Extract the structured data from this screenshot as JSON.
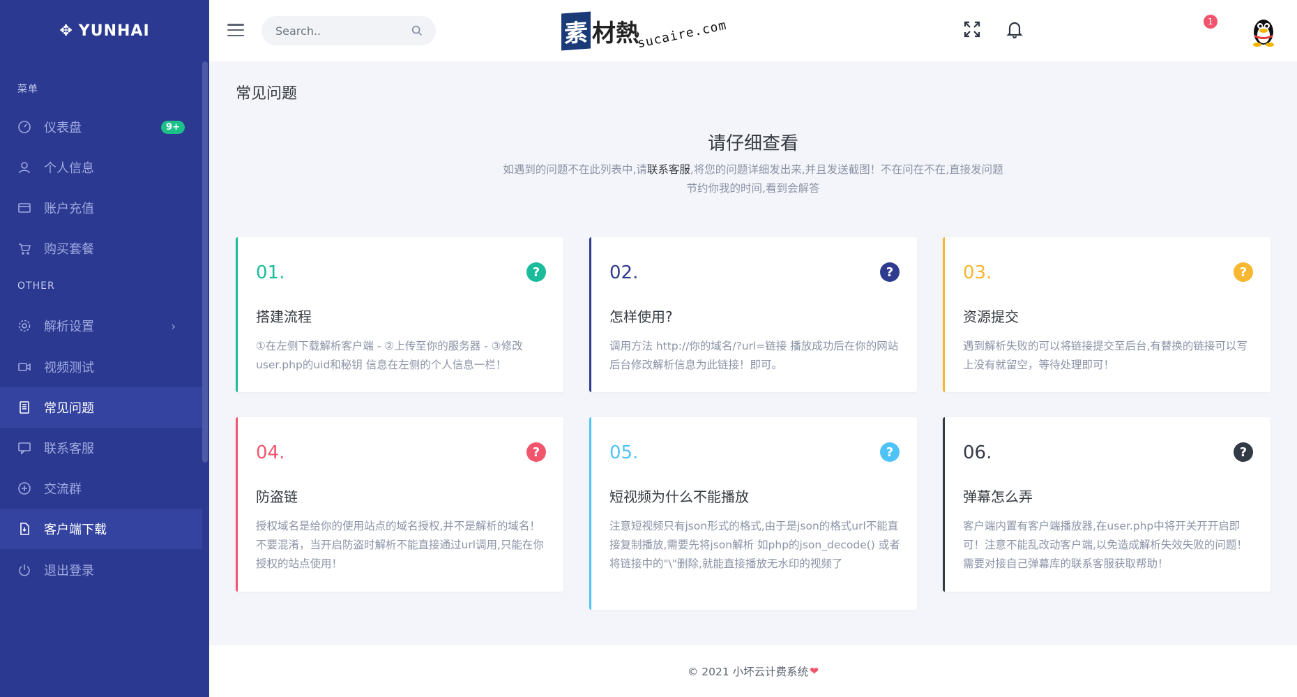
{
  "brand": {
    "name": "YUNHAI"
  },
  "sidebar": {
    "section1": "菜单",
    "section2": "OTHER",
    "items": [
      {
        "label": "仪表盘",
        "icon": "dashboard-icon",
        "badge": "9+"
      },
      {
        "label": "个人信息",
        "icon": "user-icon"
      },
      {
        "label": "账户充值",
        "icon": "credit-card-icon"
      },
      {
        "label": "购买套餐",
        "icon": "cart-icon"
      },
      {
        "label": "解析设置",
        "icon": "settings-icon",
        "has_submenu": true
      },
      {
        "label": "视频测试",
        "icon": "video-icon"
      },
      {
        "label": "常见问题",
        "icon": "document-icon",
        "active": true
      },
      {
        "label": "联系客服",
        "icon": "chat-icon"
      },
      {
        "label": "交流群",
        "icon": "plus-circle-icon"
      },
      {
        "label": "客户端下载",
        "icon": "file-download-icon",
        "active": true
      },
      {
        "label": "退出登录",
        "icon": "power-icon"
      }
    ]
  },
  "header": {
    "search_placeholder": "Search..",
    "logo_main": "素",
    "logo_rest": "材熱",
    "logo_url": "sucaire.com",
    "notification_count": "1"
  },
  "page": {
    "title": "常见问题",
    "section_title": "请仔细查看",
    "desc_part1": "如遇到的问题不在此列表中,请",
    "desc_link": "联系客服",
    "desc_part2": ",将您的问题详细发出来,并且发送截图！不在问在不在,直接发问题节约你我的时间,看到会解答"
  },
  "cards": [
    {
      "num": "01.",
      "title": "搭建流程",
      "desc": "①在左侧下载解析客户端 - ②上传至你的服务器 - ③修改user.php的uid和秘钥 信息在左侧的个人信息一栏！",
      "color": "#1abc9c"
    },
    {
      "num": "02.",
      "title": "怎样使用?",
      "desc": "调用方法 http://你的域名/?url=链接 播放成功后在你的网站后台修改解析信息为此链接！即可。",
      "color": "#2f3b8f"
    },
    {
      "num": "03.",
      "title": "资源提交",
      "desc": "遇到解析失败的可以将链接提交至后台,有替换的链接可以写上没有就留空，等待处理即可！",
      "color": "#f7b731"
    },
    {
      "num": "04.",
      "title": "防盗链",
      "desc": "授权域名是给你的使用站点的域名授权,并不是解析的域名！不要混淆，当开启防盗时解析不能直接通过url调用,只能在你授权的站点使用！",
      "color": "#f1556c"
    },
    {
      "num": "05.",
      "title": "短视频为什么不能播放",
      "desc": "注意短视频只有json形式的格式,由于是json的格式url不能直接复制播放,需要先将json解析 如php的json_decode() 或者将链接中的\"\\\"删除,就能直接播放无水印的视频了",
      "color": "#4fc3f7"
    },
    {
      "num": "06.",
      "title": "弹幕怎么弄",
      "desc": "客户端内置有客户端播放器,在user.php中将开关开开启即可！注意不能乱改动客户端,以免造成解析失效失败的问题！需要对接自己弹幕库的联系客服获取帮助！",
      "color": "#323a46"
    }
  ],
  "footer": {
    "text": "© 2021 小坏云计费系统",
    "heart": "❤"
  }
}
